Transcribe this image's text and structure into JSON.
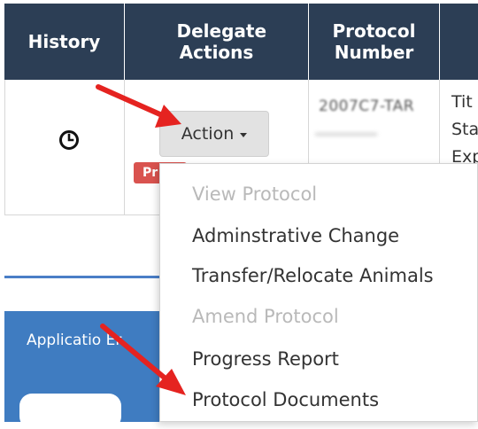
{
  "table": {
    "headers": [
      "History",
      "Delegate Actions",
      "Protocol Number"
    ],
    "row": {
      "protocol_number": "2007C7-TAR",
      "title_fragments": [
        "Tit",
        "Sta",
        "Exp"
      ],
      "action_label": "Action",
      "badge_text": "Pr"
    }
  },
  "dropdown": {
    "items": [
      {
        "label": "View Protocol",
        "disabled": true
      },
      {
        "label": "Adminstrative Change",
        "disabled": false
      },
      {
        "label": "Transfer/Relocate Animals",
        "disabled": false
      },
      {
        "label": "Amend Protocol",
        "disabled": true
      },
      {
        "label": "Progress Report",
        "disabled": false
      },
      {
        "label": "Protocol Documents",
        "disabled": false
      }
    ]
  },
  "panel": {
    "text": "Applicatio Er"
  },
  "colors": {
    "header_bg": "#2c3e55",
    "panel_bg": "#3f7cc1",
    "badge_bg": "#d9534f",
    "arrow": "#e52320"
  }
}
